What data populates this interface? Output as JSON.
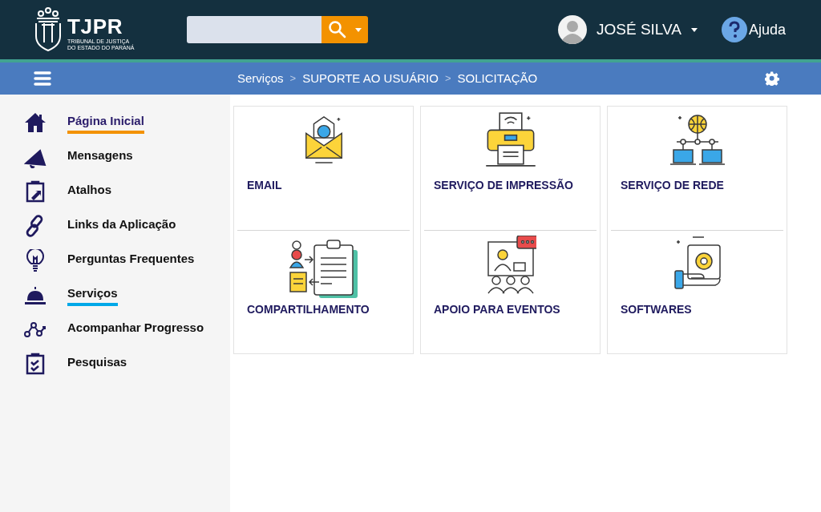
{
  "header": {
    "logo": {
      "title": "TJPR",
      "subtitle_1": "TRIBUNAL DE JUSTIÇA",
      "subtitle_2": "DO ESTADO DO PARANÁ"
    },
    "user": {
      "name": "JOSÉ SILVA"
    },
    "help": {
      "label": "Ajuda"
    }
  },
  "breadcrumb": [
    "Serviços",
    "SUPORTE AO USUÁRIO",
    "SOLICITAÇÃO"
  ],
  "breadcrumb_separator": ">",
  "sidebar": {
    "items": [
      {
        "label": "Página Inicial",
        "highlighted": true,
        "selected": false
      },
      {
        "label": "Mensagens",
        "highlighted": false,
        "selected": false
      },
      {
        "label": "Atalhos",
        "highlighted": false,
        "selected": false
      },
      {
        "label": "Links da Aplicação",
        "highlighted": false,
        "selected": false
      },
      {
        "label": "Perguntas Frequentes",
        "highlighted": false,
        "selected": false
      },
      {
        "label": "Serviços",
        "highlighted": false,
        "selected": true
      },
      {
        "label": "Acompanhar Progresso",
        "highlighted": false,
        "selected": false
      },
      {
        "label": "Pesquisas",
        "highlighted": false,
        "selected": false
      }
    ]
  },
  "services": [
    {
      "label": "EMAIL"
    },
    {
      "label": "SERVIÇO DE IMPRESSÃO"
    },
    {
      "label": "SERVIÇO DE REDE"
    },
    {
      "label": "COMPARTILHAMENTO"
    },
    {
      "label": "APOIO PARA EVENTOS"
    },
    {
      "label": "SOFTWARES"
    }
  ]
}
